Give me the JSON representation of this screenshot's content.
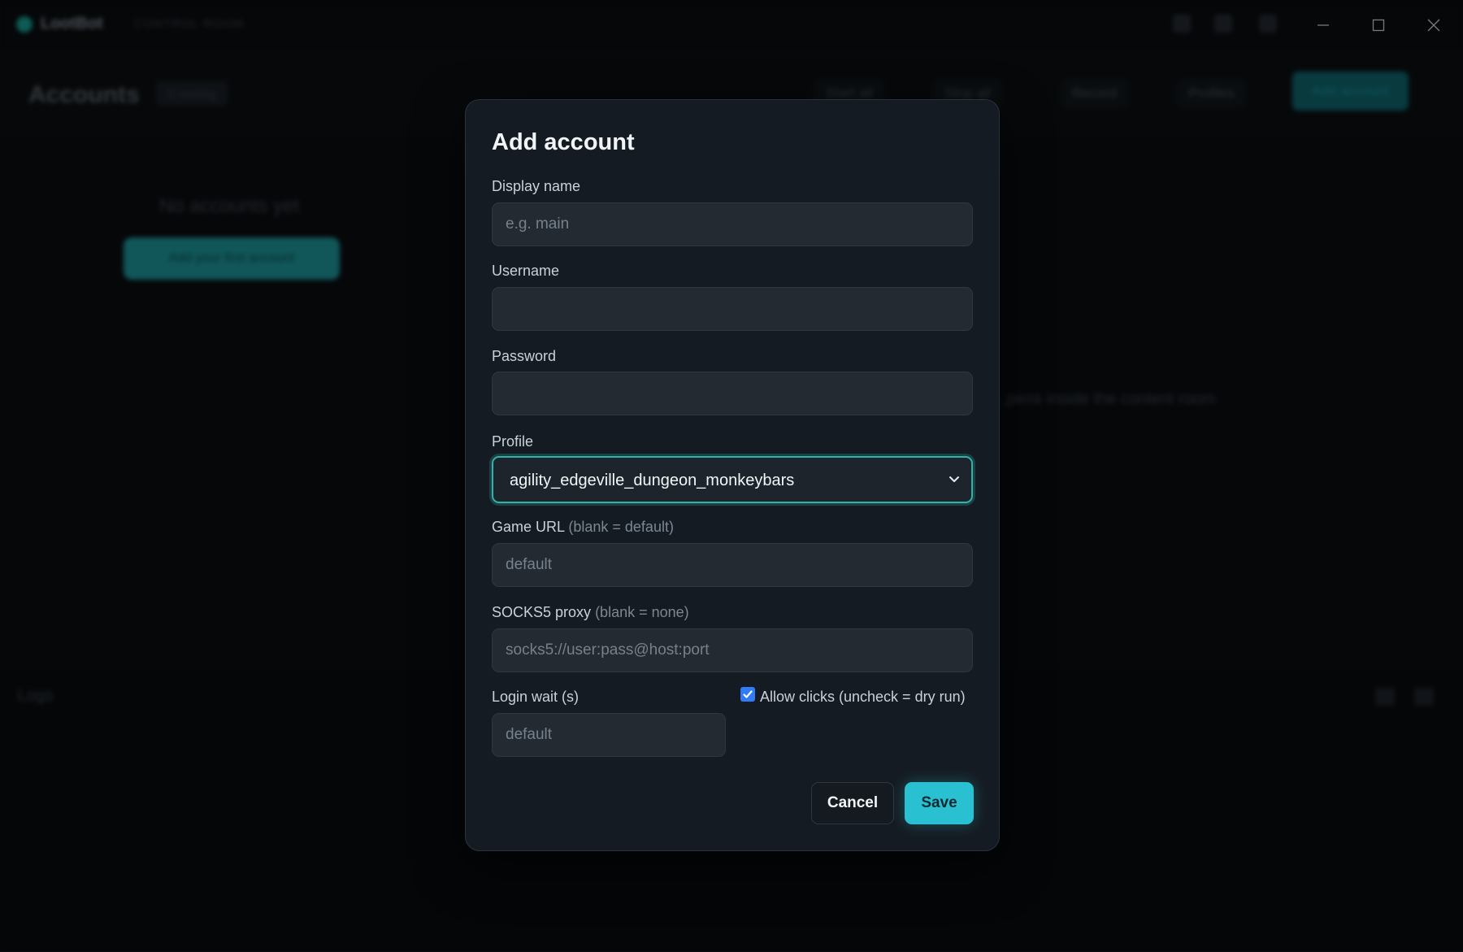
{
  "app": {
    "name": "LootBot",
    "subtitle": "CONTROL ROOM"
  },
  "header": {
    "title": "Accounts",
    "badge": "0 running",
    "start_all": "Start all",
    "stop_all": "Stop all",
    "record": "Record",
    "profiles": "Profiles",
    "add_account": "Add account"
  },
  "main": {
    "empty_text": "No accounts yet",
    "empty_button": "Add your first account",
    "hint": "...pens inside the content room"
  },
  "logs": {
    "label": "Logs"
  },
  "modal": {
    "title": "Add account",
    "display_name_label": "Display name",
    "display_name_placeholder": "e.g. main",
    "display_name_value": "",
    "username_label": "Username",
    "username_value": "",
    "password_label": "Password",
    "password_value": "",
    "profile_label": "Profile",
    "profile_value": "agility_edgeville_dungeon_monkeybars",
    "game_url_label": "Game URL",
    "game_url_hint": "(blank = default)",
    "game_url_placeholder": "default",
    "socks_label": "SOCKS5 proxy",
    "socks_hint": "(blank = none)",
    "socks_placeholder": "socks5://user:pass@host:port",
    "login_wait_label": "Login wait (s)",
    "login_wait_placeholder": "default",
    "allow_clicks_label": "Allow clicks (uncheck = dry run)",
    "allow_clicks_checked": true,
    "cancel_label": "Cancel",
    "save_label": "Save"
  },
  "colors": {
    "accent": "#29c0d2",
    "focus_ring": "#2fb3ab",
    "checkbox": "#2f7cf6"
  }
}
